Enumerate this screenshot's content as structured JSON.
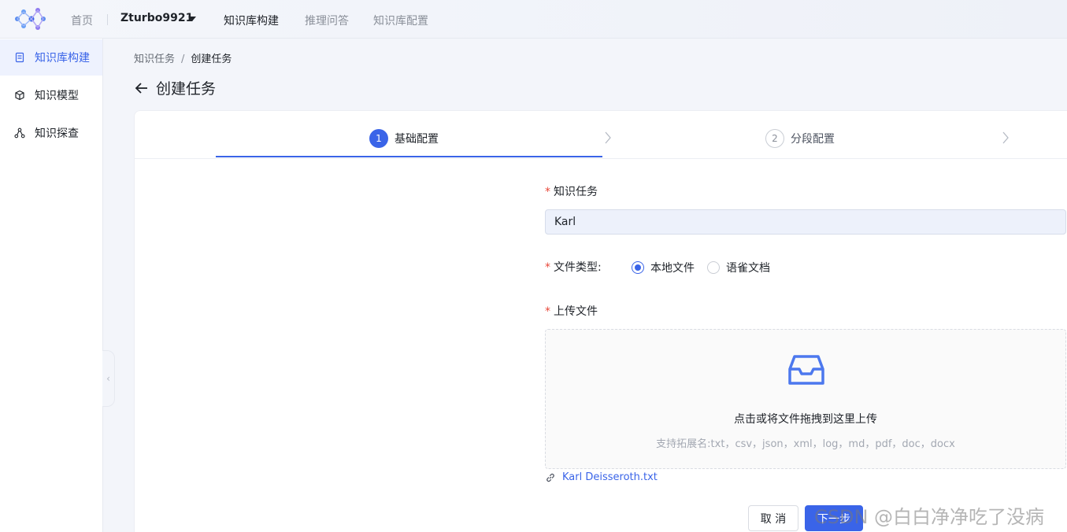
{
  "nav": {
    "home": "首页",
    "user": "Zturbo9921",
    "kb_build": "知识库构建",
    "reasoning_qa": "推理问答",
    "kb_config": "知识库配置"
  },
  "sidebar": {
    "items": [
      {
        "label": "知识库构建",
        "icon": "document-icon",
        "active": true
      },
      {
        "label": "知识模型",
        "icon": "cube-icon",
        "active": false
      },
      {
        "label": "知识探查",
        "icon": "graph-nodes-icon",
        "active": false
      }
    ],
    "collapse_glyph": "‹"
  },
  "breadcrumb": {
    "parent": "知识任务",
    "separator": "/",
    "current": "创建任务"
  },
  "page_title": "创建任务",
  "steps": [
    {
      "number": "1",
      "label": "基础配置",
      "active": true
    },
    {
      "number": "2",
      "label": "分段配置",
      "active": false
    }
  ],
  "form": {
    "task_label": "知识任务",
    "task_value": "Karl",
    "required_mark": "*",
    "file_type_label": "文件类型:",
    "file_type_options": [
      {
        "label": "本地文件",
        "checked": true
      },
      {
        "label": "语雀文档",
        "checked": false
      }
    ],
    "upload_label": "上传文件",
    "upload_text": "点击或将文件拖拽到这里上传",
    "upload_hint": "支持拓展名:txt，csv，json，xml，log，md，pdf，doc，docx",
    "uploaded_file": "Karl Deisseroth.txt"
  },
  "buttons": {
    "cancel": "取 消",
    "next": "下一步"
  },
  "watermark": "CSDN @白白净净吃了没病",
  "colors": {
    "accent": "#3a64e8",
    "required": "#e8483a"
  }
}
